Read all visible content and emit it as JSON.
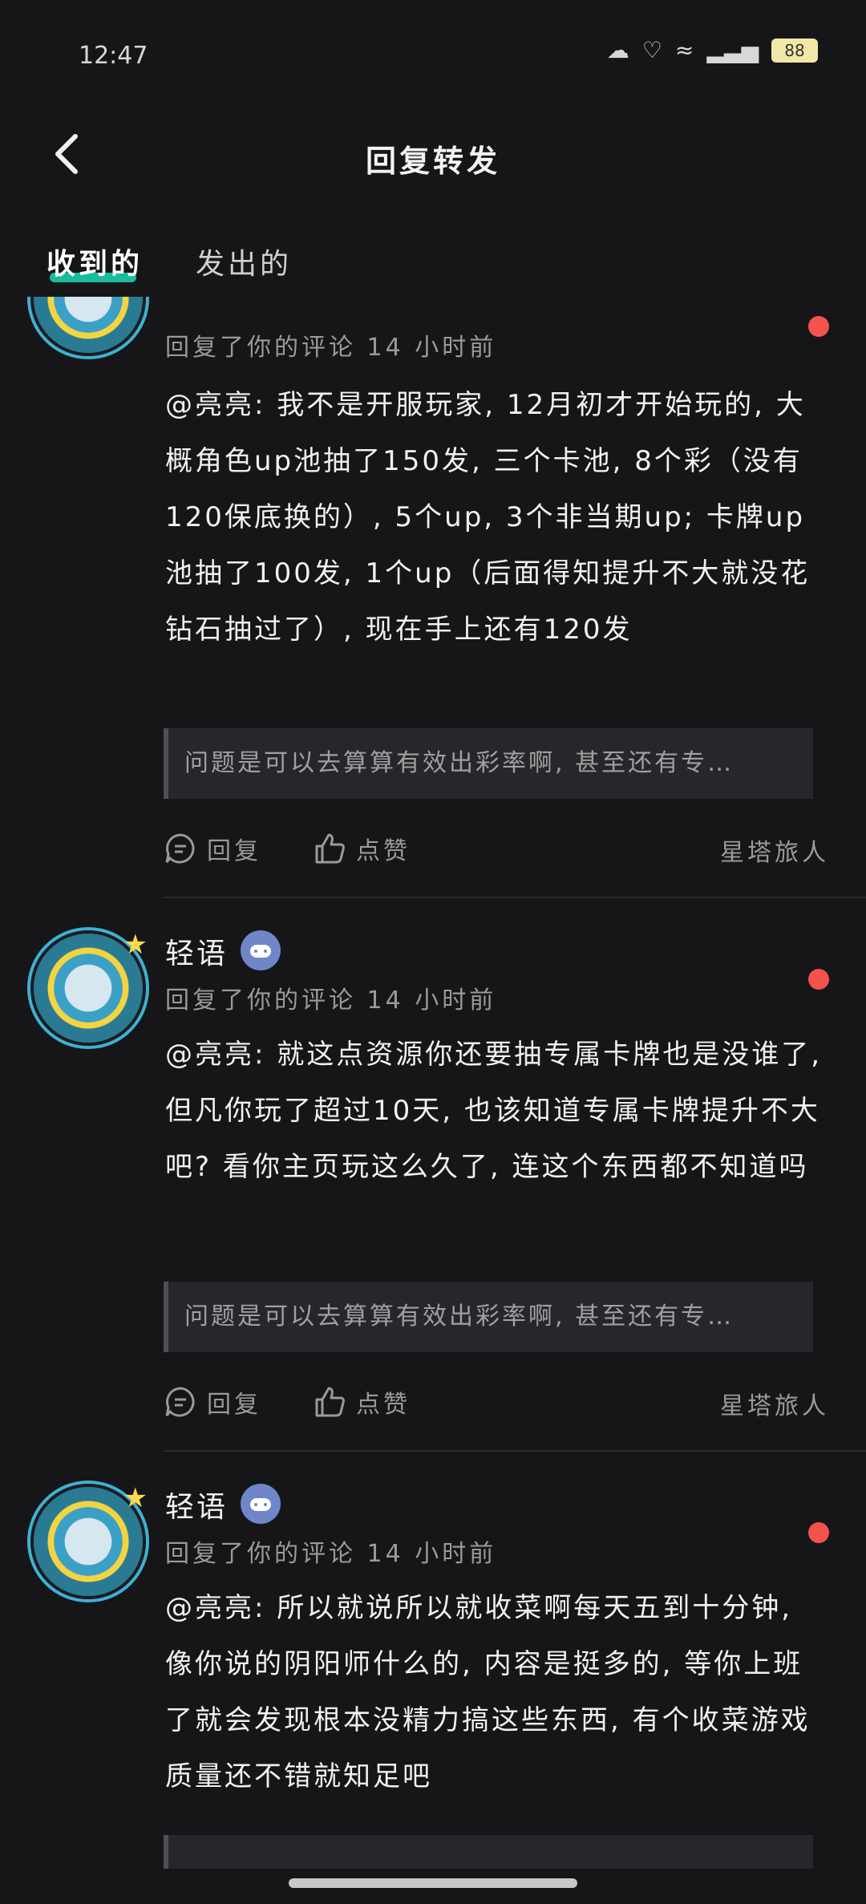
{
  "status_bar": {
    "time": "12:47",
    "battery": "88"
  },
  "header": {
    "title": "回复转发"
  },
  "tabs": [
    {
      "label": "收到的"
    },
    {
      "label": "发出的"
    }
  ],
  "items": [
    {
      "username": "",
      "meta": "回复了你的评论  14  小时前",
      "comment": "@亮亮: 我不是开服玩家, 12月初才开始玩的, 大概角色up池抽了150发, 三个卡池, 8个彩（没有120保底换的）, 5个up, 3个非当期up; 卡牌up池抽了100发, 1个up（后面得知提升不大就没花钻石抽过了）, 现在手上还有120发",
      "quote": "问题是可以去算算有效出彩率啊, 甚至还有专…",
      "reply": "回复",
      "like": "点赞",
      "source": "星塔旅人"
    },
    {
      "username": "轻语",
      "meta": "回复了你的评论  14  小时前",
      "comment": "@亮亮: 就这点资源你还要抽专属卡牌也是没谁了, 但凡你玩了超过10天, 也该知道专属卡牌提升不大吧? 看你主页玩这么久了, 连这个东西都不知道吗",
      "quote": "问题是可以去算算有效出彩率啊, 甚至还有专…",
      "reply": "回复",
      "like": "点赞",
      "source": "星塔旅人"
    },
    {
      "username": "轻语",
      "meta": "回复了你的评论  14  小时前",
      "comment": "@亮亮: 所以就说所以就收菜啊每天五到十分钟, 像你说的阴阳师什么的, 内容是挺多的, 等你上班了就会发现根本没精力搞这些东西, 有个收菜游戏质量还不错就知足吧",
      "quote": "",
      "reply": "",
      "like": "",
      "source": ""
    }
  ]
}
